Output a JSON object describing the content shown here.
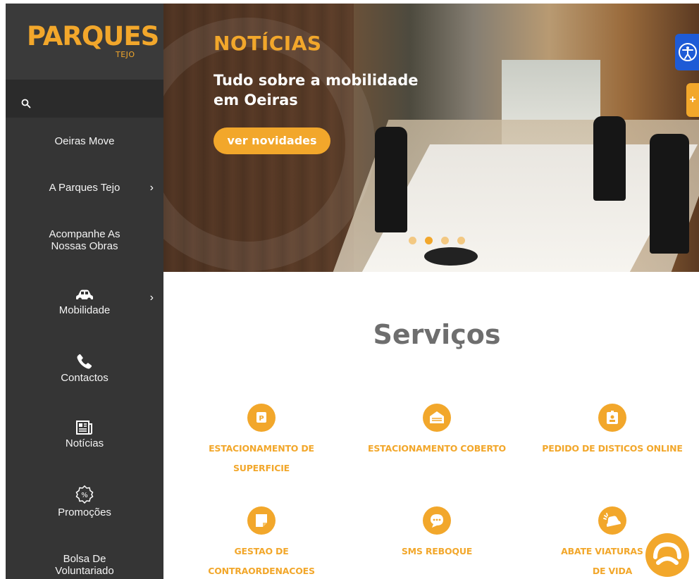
{
  "brand": {
    "logo_text": "PARQUES",
    "logo_sub": "TEJO",
    "accent": "#f2a72b"
  },
  "sidebar": {
    "search_icon": "search-icon",
    "items": [
      {
        "label": "Oeiras Move",
        "icon": "",
        "has_submenu": false
      },
      {
        "label": "A Parques Tejo",
        "icon": "",
        "has_submenu": true
      },
      {
        "label": "Acompanhe As Nossas Obras",
        "icon": "",
        "has_submenu": false
      },
      {
        "label": "Mobilidade",
        "icon": "car-icon",
        "has_submenu": true
      },
      {
        "label": "Contactos",
        "icon": "phone-icon",
        "has_submenu": false
      },
      {
        "label": "Notícias",
        "icon": "newspaper-icon",
        "has_submenu": false
      },
      {
        "label": "Promoções",
        "icon": "percent-badge-icon",
        "has_submenu": false
      },
      {
        "label": "Bolsa De Voluntariado",
        "icon": "",
        "has_submenu": false
      }
    ]
  },
  "hero": {
    "title": "NOTÍCIAS",
    "subtitle": "Tudo sobre a mobilidade em Oeiras",
    "button_label": "ver novidades",
    "slides": 4,
    "active_slide": 2
  },
  "side_tab_label": "+",
  "services": {
    "title": "Serviços",
    "items": [
      {
        "label": "ESTACIONAMENTO DE SUPERFICIE",
        "icon": "parking-icon"
      },
      {
        "label": "ESTACIONAMENTO COBERTO",
        "icon": "garage-icon"
      },
      {
        "label": "PEDIDO DE DISTICOS ONLINE",
        "icon": "badge-icon"
      },
      {
        "label": "GESTAO DE CONTRAORDENACOES",
        "icon": "document-icon"
      },
      {
        "label": "SMS REBOQUE",
        "icon": "chat-bubble-icon"
      },
      {
        "label": "ABATE VIATURAS FIM DE VIDA",
        "icon": "car-crash-icon"
      }
    ]
  }
}
